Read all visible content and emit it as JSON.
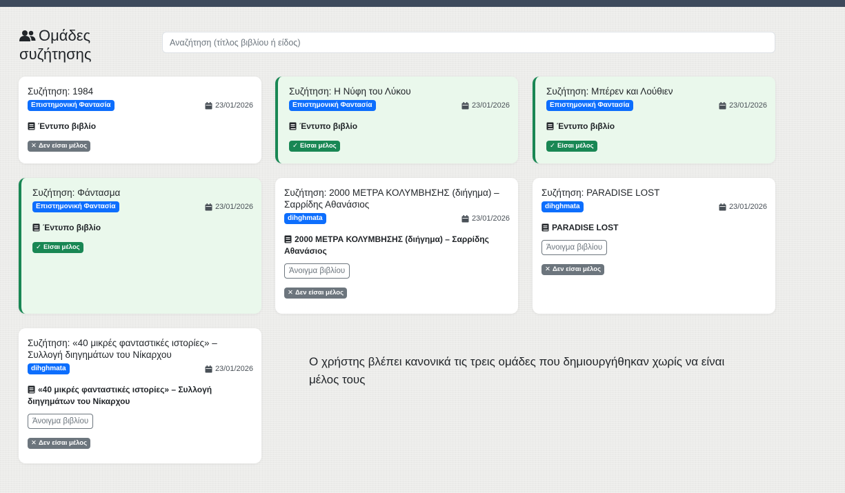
{
  "header": {
    "title": "Ομάδες συζήτησης",
    "icon": "users-icon",
    "search_placeholder": "Αναζήτηση (τίτλος βιβλίου ή είδος)"
  },
  "colors": {
    "primary": "#0d6efd",
    "success": "#198754",
    "secondary": "#6c757d",
    "member_bg": "#eaf8ec"
  },
  "groups": [
    {
      "title": "Συζήτηση: 1984",
      "genre": "Επιστημονική Φαντασία",
      "date": "23/01/2026",
      "book": "Έντυπο βιβλίο",
      "open_label": "",
      "status": "Δεν είσαι μέλος",
      "status_mark": "✕",
      "member": false
    },
    {
      "title": "Συζήτηση: Η Νύφη του Λύκου",
      "genre": "Επιστημονική Φαντασία",
      "date": "23/01/2026",
      "book": "Έντυπο βιβλίο",
      "open_label": "",
      "status": "Είσαι μέλος",
      "status_mark": "✓",
      "member": true
    },
    {
      "title": "Συζήτηση: Μπέρεν και Λούθιεν",
      "genre": "Επιστημονική Φαντασία",
      "date": "23/01/2026",
      "book": "Έντυπο βιβλίο",
      "open_label": "",
      "status": "Είσαι μέλος",
      "status_mark": "✓",
      "member": true
    },
    {
      "title": "Συζήτηση: Φάντασμα",
      "genre": "Επιστημονική Φαντασία",
      "date": "23/01/2026",
      "book": "Έντυπο βιβλίο",
      "open_label": "",
      "status": "Είσαι μέλος",
      "status_mark": "✓",
      "member": true
    },
    {
      "title": "Συζήτηση: 2000 ΜΕΤΡΑ ΚΟΛΥΜΒΗΣΗΣ (διήγημα) – Σαρρίδης Αθανάσιος",
      "genre": "dihghmata",
      "date": "23/01/2026",
      "book": "2000 ΜΕΤΡΑ ΚΟΛΥΜΒΗΣΗΣ (διήγημα) – Σαρρίδης Αθανάσιος",
      "open_label": "Άνοιγμα βιβλίου",
      "status": "Δεν είσαι μέλος",
      "status_mark": "✕",
      "member": false
    },
    {
      "title": "Συζήτηση: PARADISE LOST",
      "genre": "dihghmata",
      "date": "23/01/2026",
      "book": "PARADISE LOST",
      "open_label": "Άνοιγμα βιβλίου",
      "status": "Δεν είσαι μέλος",
      "status_mark": "✕",
      "member": false
    },
    {
      "title": "Συζήτηση: «40 μικρές φανταστικές ιστορίες» – Συλλογή διηγημάτων του Νίκαρχου",
      "genre": "dihghmata",
      "date": "23/01/2026",
      "book": "«40 μικρές φανταστικές ιστορίες» – Συλλογή διηγημάτων του Νίκαρχου",
      "open_label": "Άνοιγμα βιβλίου",
      "status": "Δεν είσαι μέλος",
      "status_mark": "✕",
      "member": false
    }
  ],
  "annotation": "Ο χρήστης βλέπει κανονικά τις τρεις ομάδες που δημιουργήθηκαν χωρίς να είναι μέλος τους"
}
